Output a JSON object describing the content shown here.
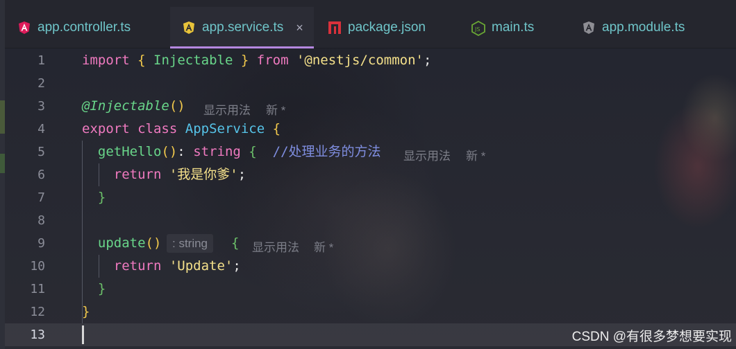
{
  "tabs": [
    {
      "label": "app.controller.ts",
      "icon": "angular-icon",
      "active": false
    },
    {
      "label": "app.service.ts",
      "icon": "angular-icon",
      "active": true,
      "close": "×"
    },
    {
      "label": "package.json",
      "icon": "npm-icon",
      "active": false
    },
    {
      "label": "main.ts",
      "icon": "nodejs-icon",
      "active": false
    },
    {
      "label": "app.module.ts",
      "icon": "angular-icon",
      "active": false
    }
  ],
  "editor": {
    "line_numbers": [
      "1",
      "2",
      "3",
      "4",
      "5",
      "6",
      "7",
      "8",
      "9",
      "10",
      "11",
      "12",
      "13"
    ],
    "current_line": "13",
    "code": {
      "l1": {
        "kw_import": "import",
        "lbrace": "{",
        "ident": "Injectable",
        "rbrace": "}",
        "kw_from": "from",
        "module": "'@nestjs/common'",
        "semi": ";"
      },
      "l3": {
        "decorator": "@Injectable",
        "parens": "()"
      },
      "l4": {
        "kw_export": "export",
        "kw_class": "class",
        "class_name": "AppService",
        "lbrace": "{"
      },
      "l5": {
        "fn": "getHello",
        "parens": "()",
        "colon": ":",
        "type": "string",
        "lbrace": "{",
        "comment": "//处理业务的方法"
      },
      "l6": {
        "kw_return": "return",
        "str": "'我是你爹'",
        "semi": ";"
      },
      "l7": {
        "rbrace": "}"
      },
      "l9": {
        "fn": "update",
        "parens": "()",
        "type_hint": ": string",
        "lbrace": "{"
      },
      "l10": {
        "kw_return": "return",
        "str": "'Update'",
        "semi": ";"
      },
      "l11": {
        "rbrace": "}"
      },
      "l12": {
        "rbrace": "}"
      }
    },
    "codelens": {
      "usages": "显示用法",
      "new": "新 *"
    }
  },
  "watermark": "CSDN @有很多梦想要实现",
  "colors": {
    "accent": "#b588e0",
    "tab_text": "#6fc5c9",
    "keyword": "#f07ac0",
    "string": "#f4e08a",
    "function": "#69d68a",
    "class": "#56c3e8",
    "comment": "#7f8ee0"
  }
}
